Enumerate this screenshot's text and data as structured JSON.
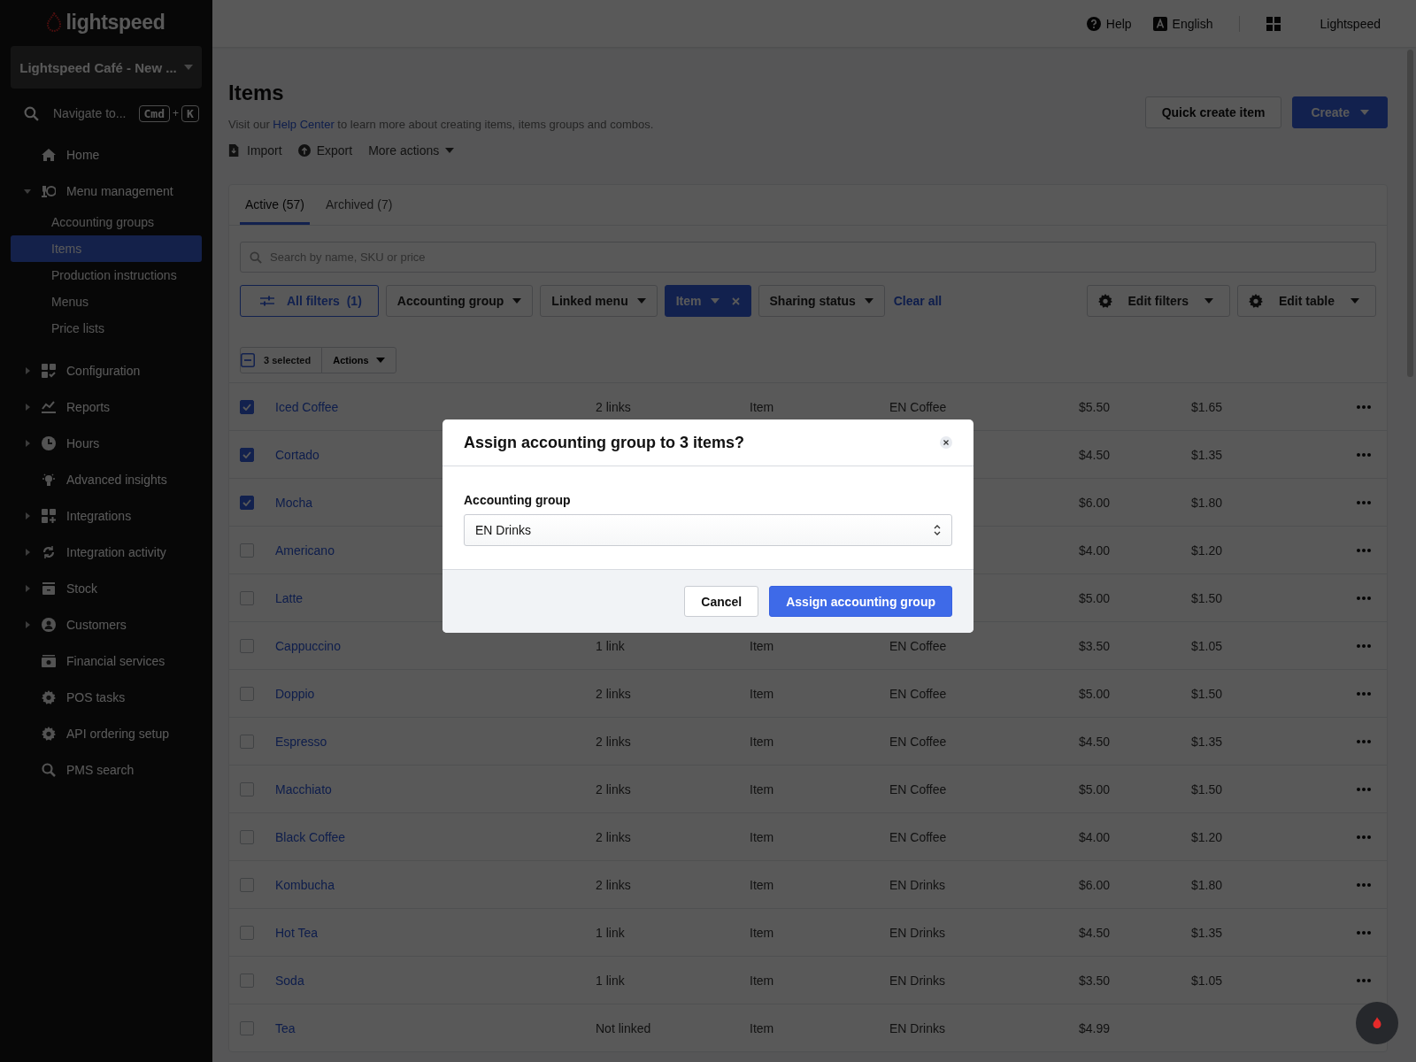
{
  "logo": {
    "text": "lightspeed"
  },
  "store_selector": {
    "label": "Lightspeed Café - New ..."
  },
  "navigate": {
    "label": "Navigate to...",
    "keys": [
      "Cmd",
      "K"
    ],
    "joiner": "+"
  },
  "sidebar": {
    "items": [
      {
        "label": "Home",
        "kind": "link"
      },
      {
        "label": "Menu management",
        "kind": "group",
        "expanded": true,
        "children": [
          {
            "label": "Accounting groups",
            "selected": false
          },
          {
            "label": "Items",
            "selected": true
          },
          {
            "label": "Production instructions",
            "selected": false
          },
          {
            "label": "Menus",
            "selected": false
          },
          {
            "label": "Price lists",
            "selected": false
          }
        ]
      },
      {
        "label": "Configuration",
        "kind": "group",
        "expanded": false
      },
      {
        "label": "Reports",
        "kind": "group",
        "expanded": false
      },
      {
        "label": "Hours",
        "kind": "group",
        "expanded": false
      },
      {
        "label": "Advanced insights",
        "kind": "link"
      },
      {
        "label": "Integrations",
        "kind": "group",
        "expanded": false
      },
      {
        "label": "Integration activity",
        "kind": "group",
        "expanded": false
      },
      {
        "label": "Stock",
        "kind": "group",
        "expanded": false
      },
      {
        "label": "Customers",
        "kind": "group",
        "expanded": false
      },
      {
        "label": "Financial services",
        "kind": "link"
      },
      {
        "label": "POS tasks",
        "kind": "link"
      },
      {
        "label": "API ordering setup",
        "kind": "link"
      },
      {
        "label": "PMS search",
        "kind": "link"
      }
    ]
  },
  "topbar": {
    "help": "Help",
    "language": "English",
    "account": "Lightspeed"
  },
  "page": {
    "title": "Items",
    "subtitle_before": "Visit our ",
    "subtitle_link": "Help Center",
    "subtitle_after": " to learn more about creating items, items groups and combos.",
    "actions": [
      "Import",
      "Export",
      "More actions"
    ],
    "buttons": [
      {
        "label": "Quick create item",
        "kind": "secondary"
      },
      {
        "label": "Create",
        "kind": "primary"
      }
    ]
  },
  "tabs": [
    {
      "label": "Active (57)",
      "selected": true
    },
    {
      "label": "Archived (7)",
      "selected": false
    }
  ],
  "search": {
    "placeholder": "Search by name, SKU or price"
  },
  "filters": [
    {
      "label": "All filters  (1)",
      "kind": "all"
    },
    {
      "label": "Accounting group",
      "kind": "dropdown",
      "applied": false
    },
    {
      "label": "Linked menu",
      "kind": "dropdown",
      "applied": false
    },
    {
      "label": "Item",
      "kind": "dropdown",
      "applied": true
    },
    {
      "label": "Sharing status",
      "kind": "dropdown",
      "applied": false
    }
  ],
  "clear_all": "Clear all",
  "table_settings": [
    "Edit filters",
    "Edit table"
  ],
  "selection": {
    "count": "3 selected",
    "actions": "Actions"
  },
  "table": {
    "rows": [
      {
        "name": "Iced Coffee",
        "links": "2 links",
        "type": "Item",
        "group": "EN Coffee",
        "price": "$5.50",
        "cost": "$1.65",
        "checked": true
      },
      {
        "name": "Cortado",
        "price": "$4.50",
        "cost": "$1.35",
        "checked": true
      },
      {
        "name": "Mocha",
        "price": "$6.00",
        "cost": "$1.80",
        "checked": true
      },
      {
        "name": "Americano",
        "price": "$4.00",
        "cost": "$1.20",
        "checked": false
      },
      {
        "name": "Latte",
        "price": "$5.00",
        "cost": "$1.50",
        "checked": false
      },
      {
        "name": "Cappuccino",
        "links": "1 link",
        "type": "Item",
        "group": "EN Coffee",
        "price": "$3.50",
        "cost": "$1.05",
        "checked": false
      },
      {
        "name": "Doppio",
        "links": "2 links",
        "type": "Item",
        "group": "EN Coffee",
        "price": "$5.00",
        "cost": "$1.50",
        "checked": false
      },
      {
        "name": "Espresso",
        "links": "2 links",
        "type": "Item",
        "group": "EN Coffee",
        "price": "$4.50",
        "cost": "$1.35",
        "checked": false
      },
      {
        "name": "Macchiato",
        "links": "2 links",
        "type": "Item",
        "group": "EN Coffee",
        "price": "$5.00",
        "cost": "$1.50",
        "checked": false
      },
      {
        "name": "Black Coffee",
        "links": "2 links",
        "type": "Item",
        "group": "EN Coffee",
        "price": "$4.00",
        "cost": "$1.20",
        "checked": false
      },
      {
        "name": "Kombucha",
        "links": "2 links",
        "type": "Item",
        "group": "EN Drinks",
        "price": "$6.00",
        "cost": "$1.80",
        "checked": false
      },
      {
        "name": "Hot Tea",
        "links": "1 link",
        "type": "Item",
        "group": "EN Drinks",
        "price": "$4.50",
        "cost": "$1.35",
        "checked": false
      },
      {
        "name": "Soda",
        "links": "1 link",
        "type": "Item",
        "group": "EN Drinks",
        "price": "$3.50",
        "cost": "$1.05",
        "checked": false
      },
      {
        "name": "Tea",
        "links": "Not linked",
        "type": "Item",
        "group": "EN Drinks",
        "price": "$4.99",
        "checked": false
      }
    ]
  },
  "modal": {
    "title": "Assign accounting group to 3 items?",
    "field_label": "Accounting group",
    "value": "EN Drinks",
    "buttons": [
      {
        "label": "Cancel",
        "kind": "secondary"
      },
      {
        "label": "Assign accounting group",
        "kind": "primary"
      }
    ]
  }
}
